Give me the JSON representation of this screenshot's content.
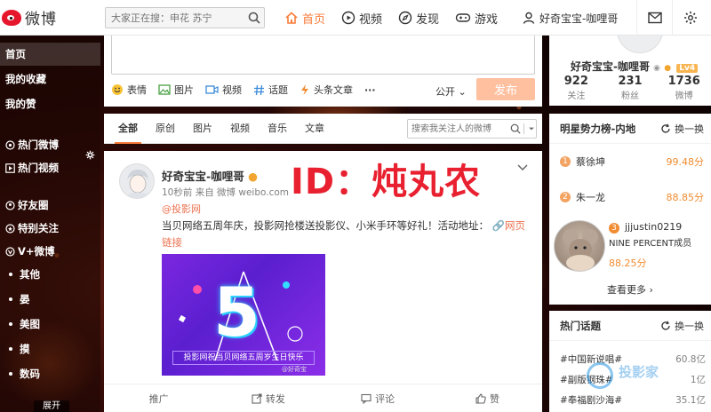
{
  "header": {
    "logo_text": "微博",
    "search_placeholder": "大家正在搜：申花 苏宁",
    "nav": [
      {
        "label": "首页",
        "icon": "home-icon",
        "active": true
      },
      {
        "label": "视频",
        "icon": "video-icon",
        "active": false
      },
      {
        "label": "发现",
        "icon": "compass-icon",
        "active": false
      },
      {
        "label": "游戏",
        "icon": "gamepad-icon",
        "active": false
      }
    ],
    "user_name": "好奇宝宝-咖哩哥"
  },
  "sidebar": {
    "items": [
      {
        "label": "首页",
        "active": true
      },
      {
        "label": "我的收藏"
      },
      {
        "label": "我的赞"
      },
      {
        "label": "热门微博"
      },
      {
        "label": "热门视频"
      },
      {
        "label": "好友圈"
      },
      {
        "label": "特别关注"
      },
      {
        "label": "V+微博"
      },
      {
        "label": "其他"
      },
      {
        "label": "晏"
      },
      {
        "label": "美图"
      },
      {
        "label": "摸"
      },
      {
        "label": "数码"
      }
    ],
    "expand_label": "展开"
  },
  "composer": {
    "tools": [
      "表情",
      "图片",
      "视频",
      "话题",
      "头条文章",
      "···"
    ],
    "visibility": "公开",
    "publish_label": "发布"
  },
  "feed_tabs": {
    "tabs": [
      "全部",
      "原创",
      "图片",
      "视频",
      "音乐",
      "文章"
    ],
    "search_placeholder": "搜索我关注人的微博"
  },
  "post": {
    "author": "好奇宝宝-咖哩哥",
    "meta": "10秒前 来自 微博 weibo.com",
    "mention": "@投影网",
    "body": "当贝网络五周年庆，投影网抢楼送投影仪、小米手环等好礼！活动地址：",
    "link_label": "网页链接",
    "overlay_text": "ID：炖丸农",
    "image": {
      "number": "5",
      "banner": "投影网祝当贝网络五周岁生日快乐",
      "watermark": "@好奇宝"
    },
    "actions": [
      "推广",
      "转发",
      "评论",
      "赞"
    ]
  },
  "profile": {
    "name": "好奇宝宝-咖哩哥",
    "level": "Lv4",
    "stats": [
      {
        "num": "922",
        "label": "关注"
      },
      {
        "num": "231",
        "label": "粉丝"
      },
      {
        "num": "1736",
        "label": "微博"
      }
    ]
  },
  "rank": {
    "title": "明星势力榜-内地",
    "refresh": "换一换",
    "rows": [
      {
        "rank": "1",
        "name": "蔡徐坤",
        "score": "99.48分"
      },
      {
        "rank": "2",
        "name": "朱一龙",
        "score": "88.85分"
      }
    ],
    "feature": {
      "rank": "3",
      "name": "jjjustin0219",
      "desc": "NINE PERCENT成员",
      "score": "88.25分"
    },
    "see_more": "查看更多"
  },
  "topics": {
    "title": "热门话题",
    "refresh": "换一换",
    "rows": [
      {
        "label": "#中国新说唱#",
        "count": "60.8亿"
      },
      {
        "label": "#副版钢珠#",
        "count": "1亿"
      },
      {
        "label": "#奉福剧沙海#",
        "count": "35.1亿"
      }
    ]
  },
  "watermark": "投影家"
}
